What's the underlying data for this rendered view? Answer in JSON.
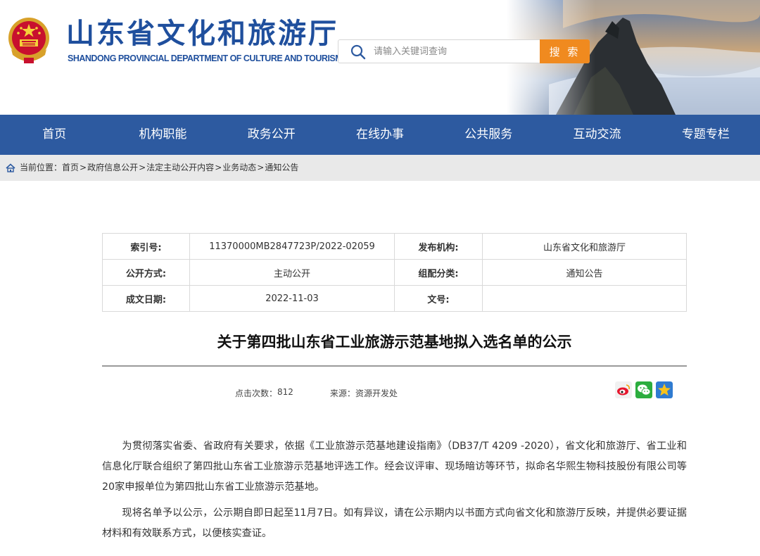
{
  "header": {
    "site_title": "山东省文化和旅游厅",
    "site_subtitle": "SHANDONG PROVINCIAL DEPARTMENT OF CULTURE AND TOURISM",
    "emblem_icon": "national-emblem-icon"
  },
  "search": {
    "placeholder": "请输入关键词查询",
    "button_label": "搜 索",
    "button_color": "#f08a1f"
  },
  "nav": {
    "background": "#2d5aa0",
    "items": [
      "首页",
      "机构职能",
      "政务公开",
      "在线办事",
      "公共服务",
      "互动交流",
      "专题专栏"
    ]
  },
  "breadcrumb": {
    "prefix": "当前位置：",
    "items": [
      "首页",
      "政府信息公开",
      "法定主动公开内容",
      "业务动态",
      "通知公告"
    ],
    "separator": ">"
  },
  "meta": {
    "index_label": "索引号:",
    "index_value": "11370000MB2847723P/2022-02059",
    "publisher_label": "发布机构:",
    "publisher_value": "山东省文化和旅游厅",
    "disclosure_label": "公开方式:",
    "disclosure_value": "主动公开",
    "category_label": "组配分类:",
    "category_value": "通知公告",
    "date_label": "成文日期:",
    "date_value": "2022-11-03",
    "docno_label": "文号:",
    "docno_value": ""
  },
  "article": {
    "title": "关于第四批山东省工业旅游示范基地拟入选名单的公示",
    "views_label": "点击次数：",
    "views_value": "812",
    "source_label": "来源：",
    "source_value": "资源开发处",
    "paragraphs": [
      "为贯彻落实省委、省政府有关要求，依据《工业旅游示范基地建设指南》（DB37/T 4209 -2020），省文化和旅游厅、省工业和信息化厅联合组织了第四批山东省工业旅游示范基地评选工作。经会议评审、现场暗访等环节，拟命名华熙生物科技股份有限公司等20家申报单位为第四批山东省工业旅游示范基地。",
      "现将名单予以公示，公示期自即日起至11月7日。如有异议，请在公示期内以书面方式向省文化和旅游厅反映，并提供必要证据材料和有效联系方式，以便核实查证。"
    ]
  },
  "share": {
    "icons": [
      "weibo-icon",
      "wechat-icon",
      "qzone-icon"
    ]
  }
}
